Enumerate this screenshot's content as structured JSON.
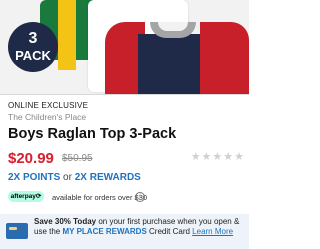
{
  "hero": {
    "badge": {
      "count": "3",
      "label": "PACK"
    },
    "colors": {
      "navy": "#1f2a48",
      "red": "#c8202a",
      "green": "#1a7a3c",
      "yellow": "#f3c316",
      "gray": "#a5a5a5",
      "white": "#ffffff"
    }
  },
  "product": {
    "tag": "ONLINE EXCLUSIVE",
    "brand": "The Children's Place",
    "title": "Boys Raglan Top 3-Pack",
    "sale_price": "$20.99",
    "original_price": "$50.95",
    "rating_stars": "★★★★★"
  },
  "rewards": {
    "points": "2X POINTS",
    "or": "or",
    "rewards": "2X REWARDS"
  },
  "afterpay": {
    "logo": "afterpay⟳",
    "text": "available for orders over $30",
    "info_icon": "i"
  },
  "promo": {
    "bold": "Save 30% Today",
    "text1": "on your first purchase when you open & use the",
    "brand": "MY PLACE REWARDS",
    "text2": "Credit Card",
    "link": "Learn More"
  }
}
